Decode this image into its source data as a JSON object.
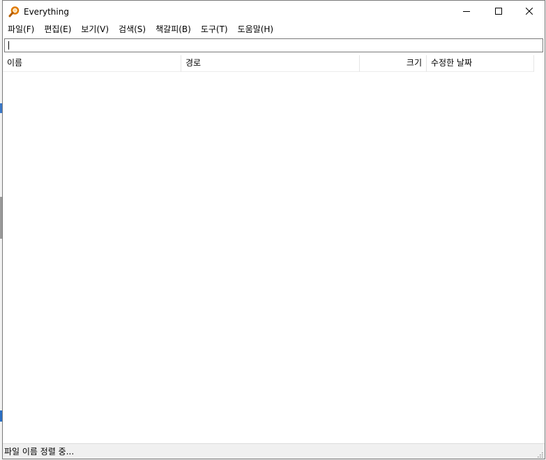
{
  "window": {
    "title": "Everything"
  },
  "menu": {
    "items": [
      "파일(F)",
      "편집(E)",
      "보기(V)",
      "검색(S)",
      "책갈피(B)",
      "도구(T)",
      "도움말(H)"
    ]
  },
  "search": {
    "value": ""
  },
  "columns": {
    "name": "이름",
    "path": "경로",
    "size": "크기",
    "modified": "수정한 날짜"
  },
  "status": {
    "text": "파일 이름 정렬 중..."
  },
  "colors": {
    "icon_orange": "#e07b00",
    "border": "#7a7a7a"
  },
  "icons": {
    "app": "magnifier-icon",
    "minimize": "minimize-icon",
    "maximize": "maximize-icon",
    "close": "close-icon",
    "grip": "resize-grip-icon"
  }
}
